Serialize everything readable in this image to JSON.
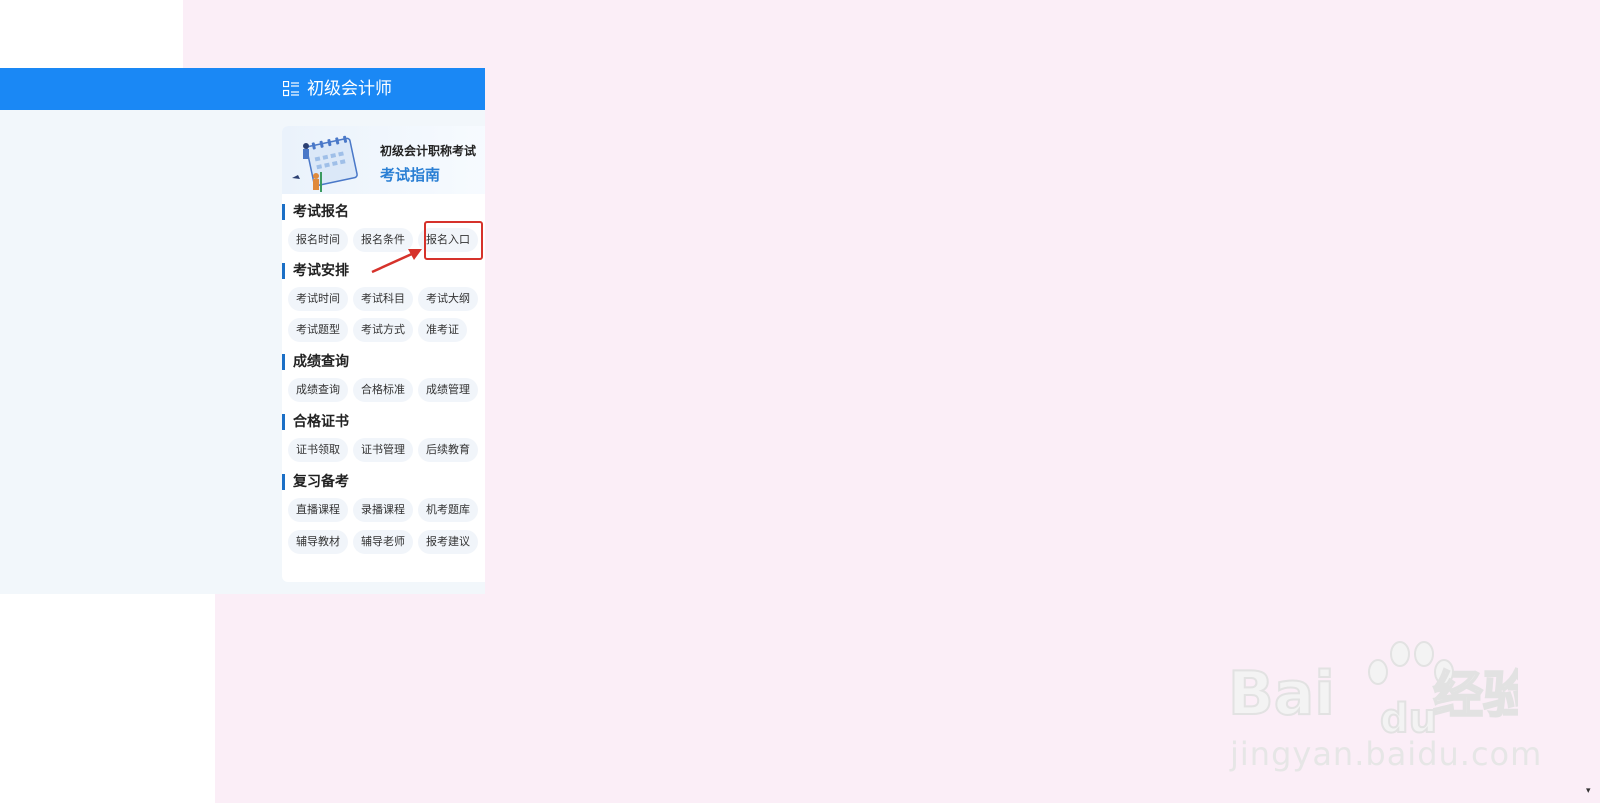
{
  "header": {
    "title": "初级会计师",
    "menu_icon": "grid-list-icon",
    "color": "#1a88f5"
  },
  "banner": {
    "line1": "初级会计职称考试",
    "line2": "考试指南",
    "illustration": "calendar-people-illustration"
  },
  "sections": [
    {
      "title": "考试报名",
      "chips": [
        "报名时间",
        "报名条件",
        "报名入口"
      ]
    },
    {
      "title": "考试安排",
      "chips": [
        "考试时间",
        "考试科目",
        "考试大纲",
        "考试题型",
        "考试方式",
        "准考证"
      ]
    },
    {
      "title": "成绩查询",
      "chips": [
        "成绩查询",
        "合格标准",
        "成绩管理"
      ]
    },
    {
      "title": "合格证书",
      "chips": [
        "证书领取",
        "证书管理",
        "后续教育"
      ]
    },
    {
      "title": "复习备考",
      "chips": [
        "直播课程",
        "录播课程",
        "机考题库",
        "辅导教材",
        "辅导老师",
        "报考建议"
      ]
    }
  ],
  "annotation": {
    "highlighted": "报名入口",
    "color": "#d6322b"
  },
  "watermark": {
    "brand": "Bai",
    "brand2": "du",
    "cn": "经验",
    "url": "jingyan.baidu.com"
  }
}
